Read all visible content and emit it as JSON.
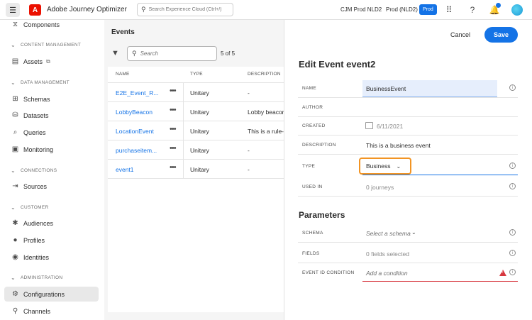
{
  "topbar": {
    "app_title": "Adobe Journey Optimizer",
    "search_placeholder": "Search Experience Cloud (Ctrl+/)",
    "org": "CJM Prod NLD2",
    "sandbox": "Prod (NLD2)",
    "sandbox_badge": "Prod",
    "logo_letter": "A"
  },
  "nav": {
    "components": "Components",
    "section_content": "CONTENT MANAGEMENT",
    "assets": "Assets",
    "section_data": "DATA MANAGEMENT",
    "schemas": "Schemas",
    "datasets": "Datasets",
    "queries": "Queries",
    "monitoring": "Monitoring",
    "section_connections": "CONNECTIONS",
    "sources": "Sources",
    "section_customer": "CUSTOMER",
    "audiences": "Audiences",
    "profiles": "Profiles",
    "identities": "Identities",
    "section_admin": "ADMINISTRATION",
    "configurations": "Configurations",
    "channels": "Channels"
  },
  "events": {
    "title": "Events",
    "search_placeholder": "Search",
    "count": "5 of 5",
    "columns": [
      "NAME",
      "TYPE",
      "DESCRIPTION"
    ],
    "rows": [
      {
        "name": "E2E_Event_R...",
        "type": "Unitary",
        "description": "-"
      },
      {
        "name": "LobbyBeacon",
        "type": "Unitary",
        "description": "Lobby beacon"
      },
      {
        "name": "LocationEvent",
        "type": "Unitary",
        "description": "This is a rule-b"
      },
      {
        "name": "purchaseitem...",
        "type": "Unitary",
        "description": "-"
      },
      {
        "name": "event1",
        "type": "Unitary",
        "description": "-"
      }
    ]
  },
  "edit": {
    "cancel": "Cancel",
    "save": "Save",
    "title": "Edit Event event2",
    "fields": {
      "name_label": "NAME",
      "name_value": "BusinessEvent",
      "author_label": "AUTHOR",
      "created_label": "CREATED",
      "created_value": "6/11/2021",
      "description_label": "DESCRIPTION",
      "description_value": "This is a business event",
      "type_label": "TYPE",
      "type_value": "Business",
      "used_in_label": "USED IN",
      "used_in_value": "0 journeys"
    },
    "parameters_title": "Parameters",
    "params": {
      "schema_label": "SCHEMA",
      "schema_placeholder": "Select a schema",
      "fields_label": "FIELDS",
      "fields_value": "0 fields selected",
      "event_id_label": "EVENT ID CONDITION",
      "event_id_placeholder": "Add a condition"
    }
  },
  "colors": {
    "accent": "#1473e6",
    "warning": "#d7373f",
    "focus": "#f29423",
    "brand": "#eb1000"
  }
}
